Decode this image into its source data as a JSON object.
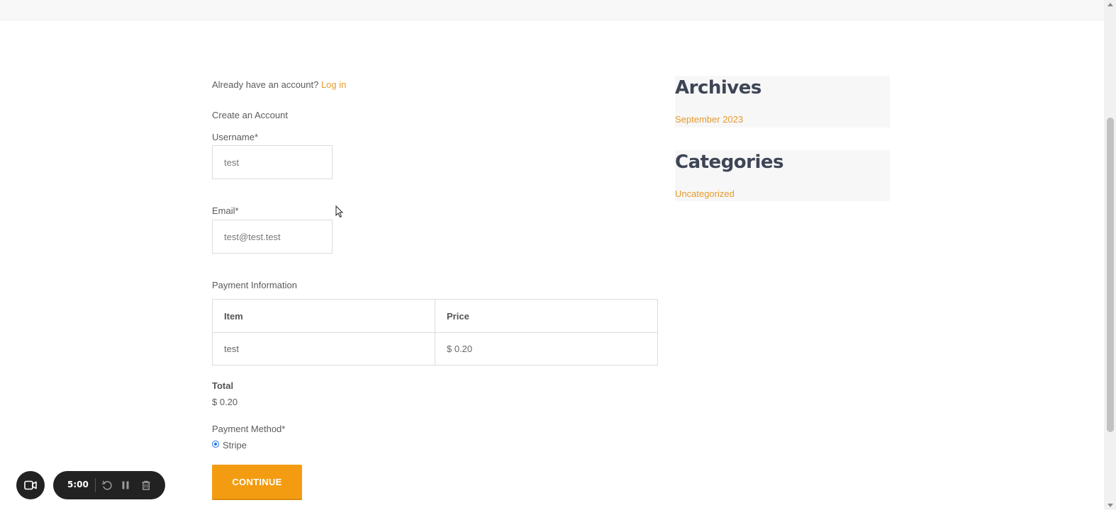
{
  "login_prompt": {
    "text": "Already have an account?",
    "link": "Log in"
  },
  "create_account": {
    "heading": "Create an Account"
  },
  "username": {
    "label": "Username*",
    "value": "test"
  },
  "email": {
    "label": "Email*",
    "value": "test@test.test"
  },
  "payment": {
    "heading": "Payment Information",
    "columns": [
      "Item",
      "Price"
    ],
    "rows": [
      {
        "item": "test",
        "price": "$ 0.20"
      }
    ]
  },
  "total": {
    "label": "Total",
    "value": "$ 0.20"
  },
  "payment_method": {
    "label": "Payment Method*",
    "option": "Stripe",
    "selected": true
  },
  "continue_button": {
    "label": "CONTINUE"
  },
  "sidebar": {
    "archives": {
      "title": "Archives",
      "items": [
        "September 2023"
      ]
    },
    "categories": {
      "title": "Categories",
      "items": [
        "Uncategorized"
      ]
    }
  },
  "recorder": {
    "time": "5:00",
    "icons": [
      "video-camera-icon",
      "restart-icon",
      "pause-icon",
      "trash-icon"
    ]
  },
  "colors": {
    "accent": "#e69a2c",
    "button": "#f39c12",
    "heading": "#3e4555"
  }
}
